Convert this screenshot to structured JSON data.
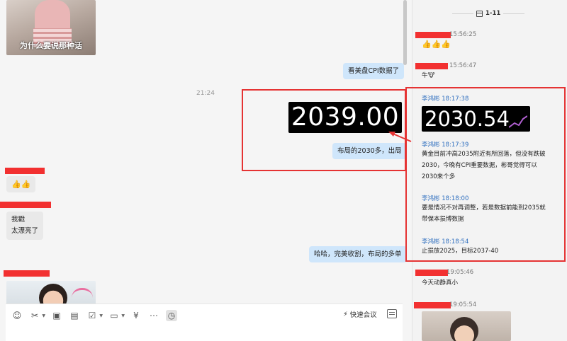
{
  "chat": {
    "top_image_caption": "为什么要说那种话",
    "msg_cpi": "看美盘CPI数据了",
    "timestamp": "21:24",
    "price_left": "2039.00",
    "msg_layout": "布局的2030多，出局",
    "msg_thumbs": "👍👍",
    "msg_wow_line1": "我戳",
    "msg_wow_line2": "太漂亮了",
    "msg_haha": "哈哈，完美收割，布局的多单"
  },
  "composer": {
    "meeting_label": "快速会议",
    "tools": [
      "emoji-icon",
      "scissors-icon",
      "image-icon",
      "document-icon",
      "checkbox-icon",
      "folder-icon",
      "gift-icon",
      "more-icon",
      "chat-history-icon"
    ]
  },
  "thread": {
    "date_label": "1-11",
    "messages": [
      {
        "time": "15:56:25",
        "text": "👍👍👍"
      },
      {
        "time": "15:56:47",
        "text": "牛🐮"
      },
      {
        "name": "李鸿彬 18:17:38"
      },
      {
        "name": "李鸿彬 18:17:39",
        "text": "黄金目前冲高2035附近有所回落，但没有跌破2030，今晚有CPI重要数据，彬哥觉得可以2030来个多"
      },
      {
        "name": "李鸿彬 18:18:00",
        "text": "要是情况不对再调整，若是数据前能到2035就带保本损博数据"
      },
      {
        "name": "李鸿彬 18:18:54",
        "text": "止损放2025，目标2037-40"
      },
      {
        "time": "19:05:46",
        "text": "今天动静真小"
      },
      {
        "time": "19:05:54"
      }
    ],
    "price_right": "2030.54"
  },
  "colors": {
    "highlight": "#e53333",
    "redaction": "#f23030",
    "out_bubble": "#cfe6fb",
    "in_bubble": "#e9e9e9",
    "name_blue": "#2f6fbf"
  }
}
